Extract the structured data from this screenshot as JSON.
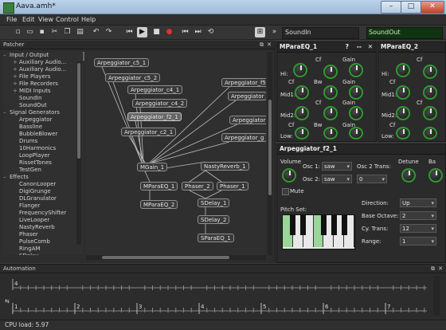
{
  "window": {
    "title": "Aava.amh*",
    "btn_min": "–",
    "btn_max": "□",
    "btn_close": "✕"
  },
  "menu": [
    "File",
    "Edit",
    "View",
    "Control",
    "Help"
  ],
  "toolbar": {
    "icons": [
      "new-icon",
      "open-icon",
      "save-icon",
      "save-as-icon",
      "cut-icon",
      "copy-icon",
      "paste-icon",
      "undo-icon",
      "redo-icon",
      "play-from-start-icon",
      "play-icon",
      "stop-icon",
      "record-icon",
      "rewind-icon",
      "forward-icon",
      "loop-icon",
      "patch-view-icon",
      "more-icon"
    ],
    "sound_in": "SoundIn",
    "sound_out": "SoundOut"
  },
  "patcher": {
    "title": "Patcher",
    "tree": [
      {
        "label": "Input / Output",
        "level": 0,
        "toggle": "–"
      },
      {
        "label": "Auxiliary Audio...",
        "level": 1,
        "toggle": "+"
      },
      {
        "label": "Auxiliary Audio...",
        "level": 1,
        "toggle": "+"
      },
      {
        "label": "File Players",
        "level": 1,
        "toggle": "+"
      },
      {
        "label": "File Recorders",
        "level": 1,
        "toggle": "+"
      },
      {
        "label": "MIDI Inputs",
        "level": 1,
        "toggle": "+"
      },
      {
        "label": "SoundIn",
        "level": 1,
        "toggle": ""
      },
      {
        "label": "SoundOut",
        "level": 1,
        "toggle": ""
      },
      {
        "label": "Signal Generators",
        "level": 0,
        "toggle": "–"
      },
      {
        "label": "Arpeggiator",
        "level": 1,
        "toggle": ""
      },
      {
        "label": "Bassline",
        "level": 1,
        "toggle": ""
      },
      {
        "label": "BubbleBlower",
        "level": 1,
        "toggle": ""
      },
      {
        "label": "Drums",
        "level": 1,
        "toggle": ""
      },
      {
        "label": "10Harmonics",
        "level": 1,
        "toggle": ""
      },
      {
        "label": "LoopPlayer",
        "level": 1,
        "toggle": ""
      },
      {
        "label": "RissetTones",
        "level": 1,
        "toggle": ""
      },
      {
        "label": "TestGen",
        "level": 1,
        "toggle": ""
      },
      {
        "label": "Effects",
        "level": 0,
        "toggle": "–"
      },
      {
        "label": "CanonLooper",
        "level": 1,
        "toggle": ""
      },
      {
        "label": "DigiGrunge",
        "level": 1,
        "toggle": ""
      },
      {
        "label": "DLGranulator",
        "level": 1,
        "toggle": ""
      },
      {
        "label": "Flanger",
        "level": 1,
        "toggle": ""
      },
      {
        "label": "FrequencyShifter",
        "level": 1,
        "toggle": ""
      },
      {
        "label": "LiveLooper",
        "level": 1,
        "toggle": ""
      },
      {
        "label": "NastyReverb",
        "level": 1,
        "toggle": ""
      },
      {
        "label": "Phaser",
        "level": 1,
        "toggle": ""
      },
      {
        "label": "PulseComb",
        "level": 1,
        "toggle": ""
      },
      {
        "label": "RingAM",
        "level": 1,
        "toggle": ""
      },
      {
        "label": "SDelay",
        "level": 1,
        "toggle": ""
      }
    ],
    "nodes": [
      {
        "label": "Arpeggiator_c5_1"
      },
      {
        "label": "Arpeggiator_c5_2"
      },
      {
        "label": "Arpeggiator_c4_1"
      },
      {
        "label": "Arpeggiator_c4_2"
      },
      {
        "label": "Arpeggiator_f2_1"
      },
      {
        "label": "Arpeggiator_c2_1"
      },
      {
        "label": "Arpeggiator_f5"
      },
      {
        "label": "Arpeggiator"
      },
      {
        "label": "Arpeggiator"
      },
      {
        "label": "Arpeggiator_g"
      },
      {
        "label": "MGain_1"
      },
      {
        "label": "NastyReverb_1"
      },
      {
        "label": "MParaEQ_1"
      },
      {
        "label": "Phaser_2"
      },
      {
        "label": "Phaser_1"
      },
      {
        "label": "MParaEQ_2"
      },
      {
        "label": "SDelay_1"
      },
      {
        "label": "SDelay_2"
      },
      {
        "label": "SParaEQ_1"
      }
    ]
  },
  "mparaeq1": {
    "title": "MParaEQ_1",
    "header_icons": [
      "?",
      "--",
      "✕"
    ],
    "labels": {
      "hi": "Hi:",
      "mid1": "Mid1:",
      "mid2": "Mid2:",
      "low": "Low:",
      "cf": "Cf",
      "bw": "Bw",
      "gain": "Gain"
    }
  },
  "mparaeq2": {
    "title": "MParaEQ_2"
  },
  "arp": {
    "title": "Arpeggiator_f2_1",
    "volume": "Volume",
    "osc1_label": "Osc 1:",
    "osc1_value": "saw",
    "osc2_label": "Osc 2:",
    "osc2_value": "saw",
    "osc2_trans_label": "Osc 2 Trans:",
    "osc2_trans_value": "0",
    "detune": "Detune",
    "ba": "Ba",
    "mute": "Mute",
    "pitch_set": "Pitch Set:",
    "direction_label": "Direction:",
    "direction_value": "Up",
    "base_octave_label": "Base Octave:",
    "base_octave_value": "2",
    "cy_trans_label": "Cy. Trans:",
    "cy_trans_value": "12",
    "range_label": "Range:",
    "range_value": "1"
  },
  "automation": {
    "title": "Automation",
    "ruler": [
      "1",
      "2",
      "3",
      "4",
      "5",
      "6",
      "7"
    ],
    "top_ruler": [
      "4"
    ]
  },
  "status": {
    "cpu": "CPU load: 5.97"
  }
}
